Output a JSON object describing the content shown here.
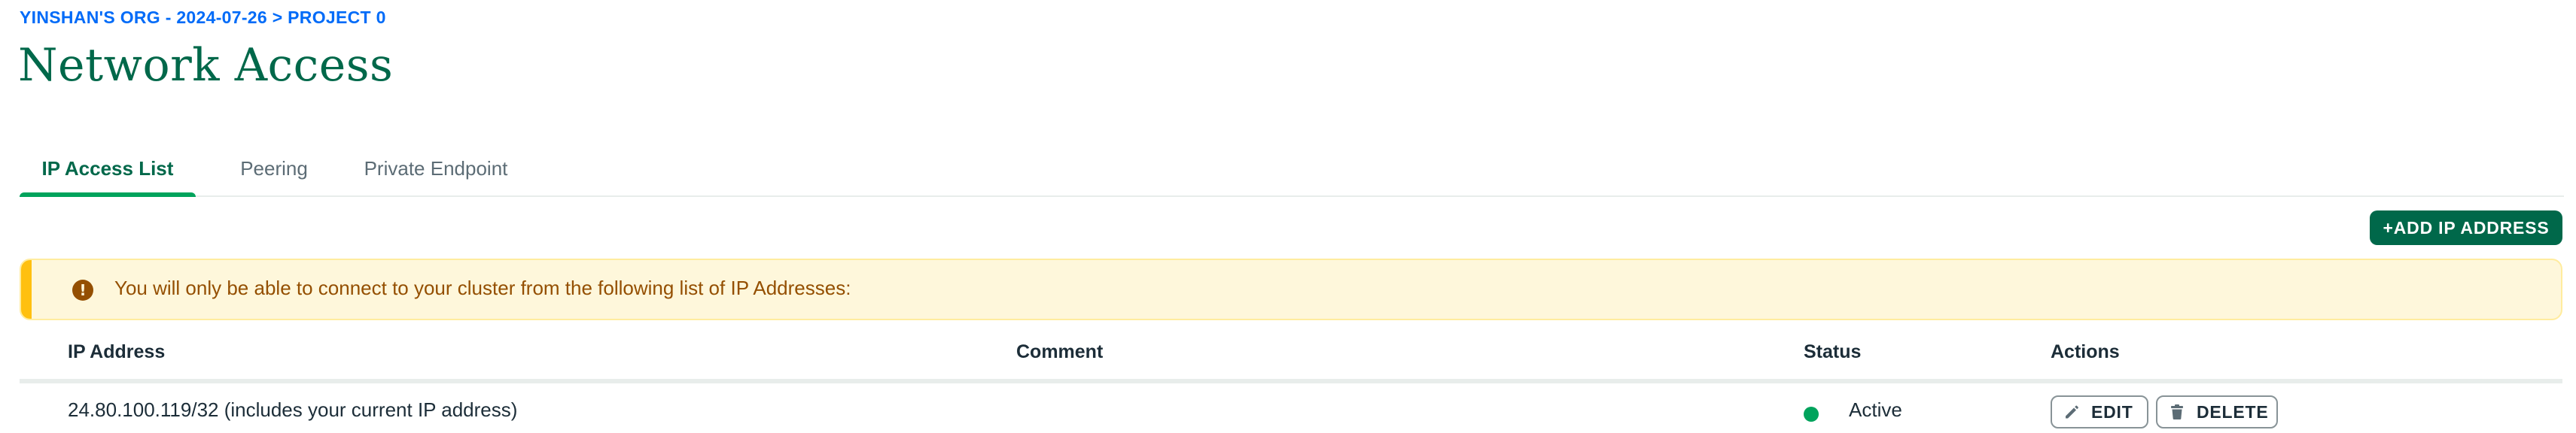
{
  "breadcrumb": {
    "org": "YINSHAN'S ORG - 2024-07-26",
    "separator": ">",
    "project": "PROJECT 0"
  },
  "page_title": "Network Access",
  "tabs": [
    {
      "label": "IP Access List",
      "active": true
    },
    {
      "label": "Peering",
      "active": false
    },
    {
      "label": "Private Endpoint",
      "active": false
    }
  ],
  "add_button": {
    "plus": "+",
    "label": "ADD IP ADDRESS"
  },
  "banner": {
    "icon": "warning-icon",
    "icon_glyph": "!",
    "text": "You will only be able to connect to your cluster from the following list of IP Addresses:"
  },
  "table": {
    "headers": {
      "ip": "IP Address",
      "comment": "Comment",
      "status": "Status",
      "actions": "Actions"
    },
    "rows": [
      {
        "ip": "24.80.100.119/32",
        "ip_note": "(includes your current IP address)",
        "comment": "",
        "status": "Active",
        "actions": {
          "edit": "EDIT",
          "delete": "DELETE"
        }
      }
    ]
  },
  "colors": {
    "brand_green": "#00684a",
    "tab_indicator": "#00a35c",
    "link_blue": "#016bf8",
    "warning_bg": "#fef7db",
    "warning_accent": "#ffc010",
    "warning_text": "#944f01",
    "status_active": "#00a35c"
  }
}
